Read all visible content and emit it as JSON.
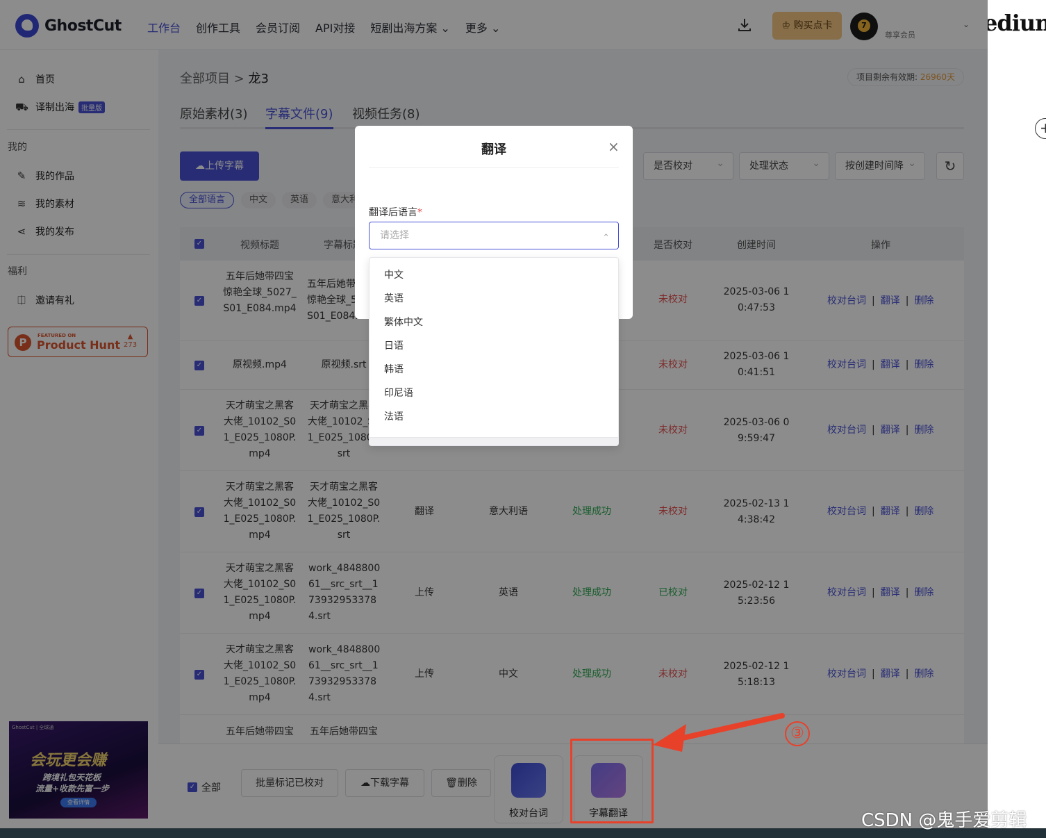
{
  "header": {
    "logo_text": "GhostCut",
    "nav": [
      "工作台",
      "创作工具",
      "会员订阅",
      "API对接",
      "短剧出海方案 ⌄",
      "更多 ⌄"
    ],
    "buy_label": "购买点卡",
    "avatar_level": "7",
    "user_sub": "尊享会员"
  },
  "sidebar": {
    "home": "首页",
    "translate": "译制出海",
    "translate_badge": "批量版",
    "section_mine": "我的",
    "works": "我的作品",
    "materials": "我的素材",
    "publish": "我的发布",
    "section_welfare": "福利",
    "invite": "邀请有礼",
    "ph_small": "FEATURED ON",
    "ph_big": "Product Hunt",
    "ph_count": "273",
    "promo_tag": "GhostCut | 全球通",
    "promo_t1": "会玩更会赚",
    "promo_t2": "跨境礼包天花板",
    "promo_t3": "流量+收款先富一步",
    "promo_btn": "查看详情"
  },
  "main": {
    "crumb_root": "全部项目",
    "crumb_sep": " > ",
    "crumb_current": "龙3",
    "expire_label": "项目剩余有效期: ",
    "expire_value": "26960天",
    "tabs": [
      "原始素材(3)",
      "字幕文件(9)",
      "视频任务(8)"
    ],
    "upload_label": "上传字幕",
    "filters": [
      "是否校对",
      "处理状态",
      "按创建时间降"
    ],
    "chips": [
      "全部语言",
      "中文",
      "英语",
      "意大利语"
    ],
    "headers": [
      "视频标题",
      "字幕标题",
      "是否校对",
      "创建时间",
      "操作"
    ],
    "rows": [
      {
        "video": "五年后她带四宝惊艳全球_5027_S01_E084.mp4",
        "sub": "五年后她带四宝惊艳全球_5027_S01_E084.srt",
        "source": "",
        "lang": "",
        "status": "",
        "checked": "未校对",
        "time": "2025-03-06 10:47:53"
      },
      {
        "video": "原视频.mp4",
        "sub": "原视频.srt",
        "source": "",
        "lang": "",
        "status": "",
        "checked": "未校对",
        "time": "2025-03-06 10:41:51"
      },
      {
        "video": "天才萌宝之黑客大佬_10102_S01_E025_1080P.mp4",
        "sub": "天才萌宝之黑客大佬_10102_S01_E025_1080P.srt",
        "source": "",
        "lang": "",
        "status": "",
        "checked": "未校对",
        "time": "2025-03-06 09:59:47"
      },
      {
        "video": "天才萌宝之黑客大佬_10102_S01_E025_1080P.mp4",
        "sub": "天才萌宝之黑客大佬_10102_S01_E025_1080P.srt",
        "source": "翻译",
        "lang": "意大利语",
        "status": "处理成功",
        "checked": "未校对",
        "time": "2025-02-13 14:38:42"
      },
      {
        "video": "天才萌宝之黑客大佬_10102_S01_E025_1080P.mp4",
        "sub": "work_484880061__src_srt__1739329533784.srt",
        "source": "上传",
        "lang": "英语",
        "status": "处理成功",
        "checked": "已校对",
        "time": "2025-02-12 15:23:56"
      },
      {
        "video": "天才萌宝之黑客大佬_10102_S01_E025_1080P.mp4",
        "sub": "work_484880061__src_srt__1739329533784.srt",
        "source": "上传",
        "lang": "中文",
        "status": "处理成功",
        "checked": "未校对",
        "time": "2025-02-12 15:18:13"
      },
      {
        "video": "五年后她带四宝",
        "sub": "五年后她带四宝"
      }
    ],
    "ops": [
      "校对台词",
      "翻译",
      "删除"
    ],
    "ops_sep": "|",
    "bottom": {
      "all_label": "全部",
      "mark_checked": "批量标记已校对",
      "download": "下载字幕",
      "delete": "删除",
      "tool_proofread": "校对台词",
      "tool_translate": "字幕翻译"
    }
  },
  "modal": {
    "title": "翻译",
    "close": "×",
    "field_label": "翻译后语言",
    "required_mark": "*",
    "placeholder": "请选择",
    "options": [
      "中文",
      "英语",
      "繁体中文",
      "日语",
      "韩语",
      "印尼语",
      "法语"
    ]
  },
  "annotation": {
    "marker": "③"
  },
  "right_pane": {
    "brand": "edium",
    "plus": "+"
  },
  "watermark": "CSDN @鬼手爱剪辑",
  "colors": {
    "primary": "#4750d6",
    "success": "#2faa52",
    "danger": "#e34d4d",
    "annotation": "#e8412a"
  }
}
